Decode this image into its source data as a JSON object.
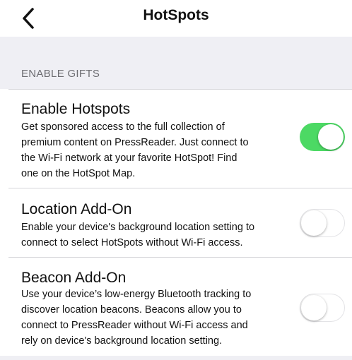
{
  "nav": {
    "back_icon": "chevron-left-icon",
    "title": "HotSpots"
  },
  "section": {
    "header": "ENABLE GIFTS"
  },
  "settings": [
    {
      "title": "Enable Hotspots",
      "description_lines": [
        "Get sponsored access to the full collection of",
        "premium content on PressReader. Just connect to",
        "the Wi-Fi network at your favorite HotSpot! Find",
        "one on the HotSpot Map."
      ],
      "enabled": true
    },
    {
      "title": "Location Add-On",
      "description_lines": [
        "Enable your device's background location setting to",
        "connect to select HotSpots without Wi-Fi access."
      ],
      "enabled": false
    },
    {
      "title": "Beacon Add-On",
      "description_lines": [
        "Use your device’s low-energy Bluetooth tracking to",
        "discover location beacons. Beacons allow you to",
        "connect to PressReader without Wi-Fi access and",
        "rely on device's background location setting."
      ],
      "enabled": false
    }
  ],
  "colors": {
    "toggle_on": "#4cd964",
    "background_gray": "#efeff4"
  }
}
